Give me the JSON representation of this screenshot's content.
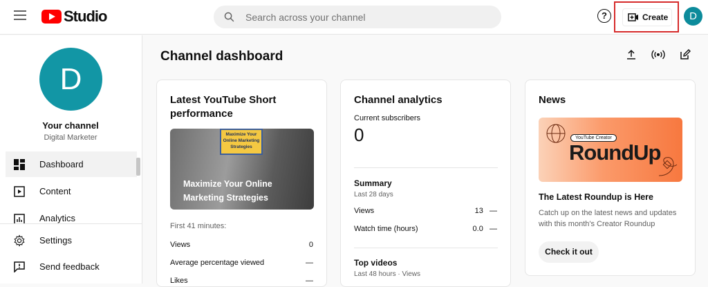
{
  "header": {
    "logo_text": "Studio",
    "search_placeholder": "Search across your channel",
    "help_label": "?",
    "create_label": "Create",
    "avatar_letter": "D"
  },
  "sidebar": {
    "avatar_letter": "D",
    "channel_name": "Your channel",
    "channel_subtitle": "Digital Marketer",
    "items": [
      {
        "label": "Dashboard",
        "icon": "dashboard-icon"
      },
      {
        "label": "Content",
        "icon": "content-icon"
      },
      {
        "label": "Analytics",
        "icon": "analytics-icon"
      },
      {
        "label": "Settings",
        "icon": "gear-icon"
      },
      {
        "label": "Send feedback",
        "icon": "feedback-icon"
      }
    ]
  },
  "main": {
    "title": "Channel dashboard",
    "actions": [
      "upload-icon",
      "live-icon",
      "edit-icon"
    ]
  },
  "short_card": {
    "title": "Latest YouTube Short performance",
    "thumb_board_text": "Maximize Your Online Marketing Strategies",
    "thumb_caption": "Maximize Your Online Marketing Strategies",
    "period_label": "First 41 minutes:",
    "rows": [
      {
        "label": "Views",
        "value": "0"
      },
      {
        "label": "Average percentage viewed",
        "value": "—"
      },
      {
        "label": "Likes",
        "value": "—"
      }
    ]
  },
  "analytics_card": {
    "title": "Channel analytics",
    "subscribers_label": "Current subscribers",
    "subscribers_value": "0",
    "summary_title": "Summary",
    "summary_period": "Last 28 days",
    "rows": [
      {
        "label": "Views",
        "value": "13",
        "trend": "—"
      },
      {
        "label": "Watch time (hours)",
        "value": "0.0",
        "trend": "—"
      }
    ],
    "top_videos_title": "Top videos",
    "top_videos_period": "Last 48 hours · Views"
  },
  "news_card": {
    "title": "News",
    "image_pill": "YouTube Creator",
    "image_headline": "RoundUp",
    "headline": "The Latest Roundup is Here",
    "body": "Catch up on the latest news and updates with this month's Creator Roundup",
    "cta": "Check it out"
  },
  "colors": {
    "brand_red": "#ff0000",
    "avatar_teal": "#1296a5",
    "highlight_red": "#d62a2a"
  }
}
